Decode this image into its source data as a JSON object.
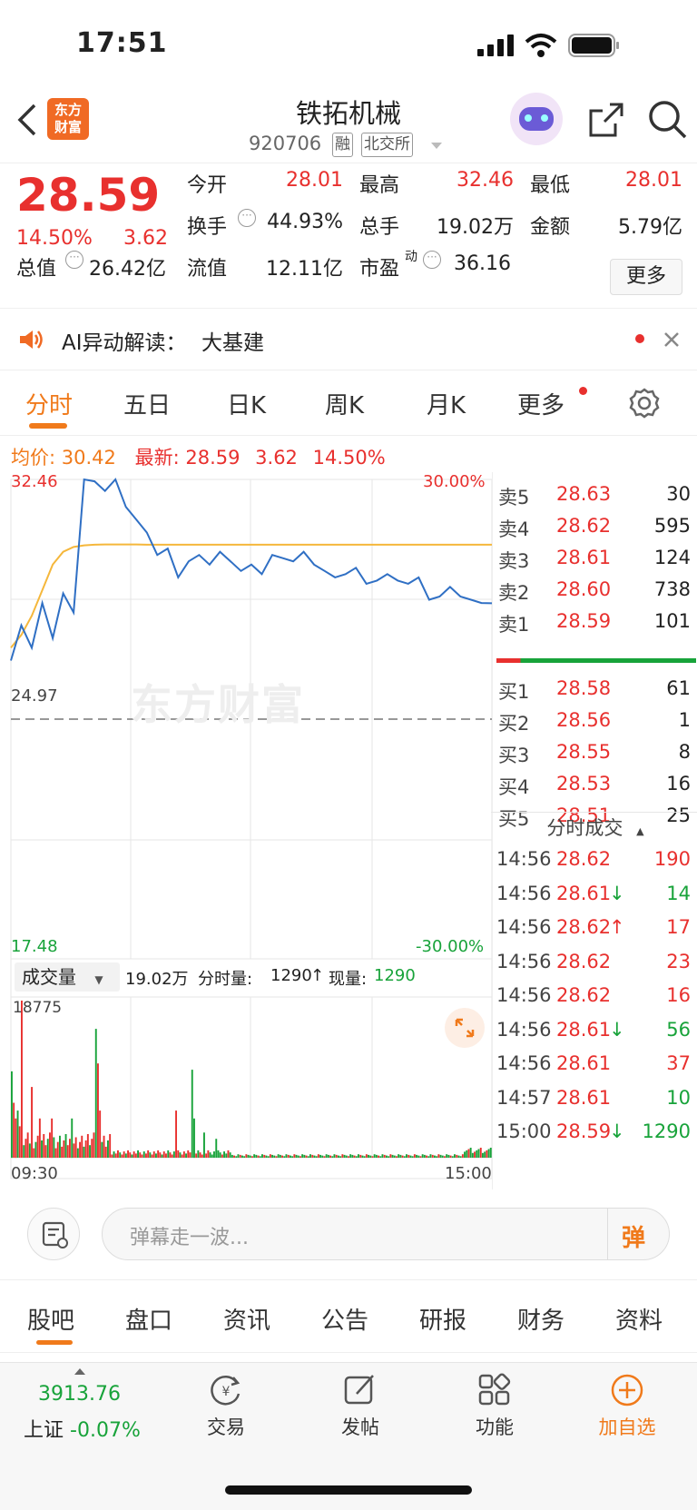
{
  "status": {
    "time": "17:51"
  },
  "header": {
    "logo_text_1": "东方",
    "logo_text_2": "财富",
    "stock_name": "铁拓机械",
    "stock_code": "920706",
    "tag_margin": "融",
    "tag_exchange": "北交所"
  },
  "quote": {
    "price": "28.59",
    "change_pct": "14.50%",
    "change_amt": "3.62",
    "open_label": "今开",
    "open": "28.01",
    "high_label": "最高",
    "high": "32.46",
    "low_label": "最低",
    "low": "28.01",
    "turnover_label": "换手",
    "turnover": "44.93%",
    "volume_label": "总手",
    "volume": "19.02万",
    "amount_label": "金额",
    "amount": "5.79亿",
    "mktcap_label": "总值",
    "mktcap": "26.42亿",
    "float_label": "流值",
    "float": "12.11亿",
    "pe_label": "市盈",
    "pe_sup": "动",
    "pe": "36.16",
    "more": "更多"
  },
  "ai": {
    "label": "AI异动解读：",
    "topic": "大基建"
  },
  "tabs": [
    "分时",
    "五日",
    "日K",
    "周K",
    "月K",
    "更多"
  ],
  "avg": {
    "avg_label": "均价:",
    "avg_value": "30.42",
    "latest_label": "最新:",
    "latest_value": "28.59",
    "chg": "3.62",
    "pct": "14.50%"
  },
  "chart_labels": {
    "top_price": "32.46",
    "top_pct": "30.00%",
    "mid_price": "24.97",
    "bottom_price": "17.48",
    "bottom_pct": "-30.00%",
    "watermark": "东方财富",
    "vol_selector": "成交量",
    "vol_total": "19.02万",
    "vol_minute_label": "分时量:",
    "vol_minute": "1290",
    "vol_now_label": "现量:",
    "vol_now": "1290",
    "vol_max": "18775",
    "time_start": "09:30",
    "time_end": "15:00"
  },
  "colors": {
    "accent": "#f07a1b",
    "up": "#e8302e",
    "down": "#18a33a",
    "price_line": "#2f6fc4",
    "avg_line": "#f5b73b"
  },
  "chart_data": {
    "type": "line",
    "ylim": [
      17.48,
      32.46
    ],
    "series": [
      {
        "name": "价格",
        "values": [
          26.8,
          27.9,
          27.2,
          28.6,
          27.5,
          28.9,
          28.3,
          32.46,
          32.4,
          32.1,
          32.46,
          31.6,
          31.2,
          30.8,
          30.1,
          30.3,
          29.4,
          29.9,
          30.1,
          29.8,
          30.2,
          29.9,
          29.6,
          29.8,
          29.5,
          30.1,
          30.0,
          29.9,
          30.2,
          29.8,
          29.6,
          29.4,
          29.5,
          29.7,
          29.2,
          29.3,
          29.5,
          29.3,
          29.2,
          29.4,
          28.7,
          28.8,
          29.1,
          28.8,
          28.7,
          28.6,
          28.59
        ]
      },
      {
        "name": "均价",
        "values": [
          27.2,
          27.6,
          28.2,
          29.0,
          29.8,
          30.2,
          30.35,
          30.4,
          30.42,
          30.43,
          30.43,
          30.43,
          30.43,
          30.42,
          30.42,
          30.42,
          30.42,
          30.42,
          30.42,
          30.42,
          30.42,
          30.42,
          30.42,
          30.42,
          30.42,
          30.42,
          30.42,
          30.42,
          30.42,
          30.42,
          30.42,
          30.42,
          30.42,
          30.42,
          30.42,
          30.42,
          30.42,
          30.42,
          30.42,
          30.42,
          30.42,
          30.42,
          30.42,
          30.42,
          30.42,
          30.42,
          30.42
        ]
      }
    ]
  },
  "order_book": {
    "sell": [
      {
        "label": "卖5",
        "price": "28.63",
        "vol": "30"
      },
      {
        "label": "卖4",
        "price": "28.62",
        "vol": "595"
      },
      {
        "label": "卖3",
        "price": "28.61",
        "vol": "124"
      },
      {
        "label": "卖2",
        "price": "28.60",
        "vol": "738"
      },
      {
        "label": "卖1",
        "price": "28.59",
        "vol": "101"
      }
    ],
    "buy": [
      {
        "label": "买1",
        "price": "28.58",
        "vol": "61"
      },
      {
        "label": "买2",
        "price": "28.56",
        "vol": "1"
      },
      {
        "label": "买3",
        "price": "28.55",
        "vol": "8"
      },
      {
        "label": "买4",
        "price": "28.53",
        "vol": "16"
      },
      {
        "label": "买5",
        "price": "28.51",
        "vol": "25"
      }
    ]
  },
  "ticks": {
    "header": "分时成交",
    "rows": [
      {
        "time": "14:56",
        "price": "28.62",
        "arrow": "",
        "vol": "190",
        "dir": "up"
      },
      {
        "time": "14:56",
        "price": "28.61",
        "arrow": "↓",
        "vol": "14",
        "dir": "down"
      },
      {
        "time": "14:56",
        "price": "28.62",
        "arrow": "↑",
        "vol": "17",
        "dir": "up"
      },
      {
        "time": "14:56",
        "price": "28.62",
        "arrow": "",
        "vol": "23",
        "dir": "up"
      },
      {
        "time": "14:56",
        "price": "28.62",
        "arrow": "",
        "vol": "16",
        "dir": "up"
      },
      {
        "time": "14:56",
        "price": "28.61",
        "arrow": "↓",
        "vol": "56",
        "dir": "down"
      },
      {
        "time": "14:56",
        "price": "28.61",
        "arrow": "",
        "vol": "37",
        "dir": "up"
      },
      {
        "time": "14:57",
        "price": "28.61",
        "arrow": "",
        "vol": "10",
        "dir": "down"
      },
      {
        "time": "15:00",
        "price": "28.59",
        "arrow": "↓",
        "vol": "1290",
        "dir": "down"
      }
    ]
  },
  "danmu": {
    "placeholder": "弹幕走一波...",
    "send": "弹"
  },
  "subtabs": [
    "股吧",
    "盘口",
    "资讯",
    "公告",
    "研报",
    "财务",
    "资料"
  ],
  "bottom_nav": {
    "index_value": "3913.76",
    "index_name": "上证",
    "index_pct": "-0.07%",
    "trade": "交易",
    "post": "发帖",
    "func": "功能",
    "add": "加自选"
  }
}
